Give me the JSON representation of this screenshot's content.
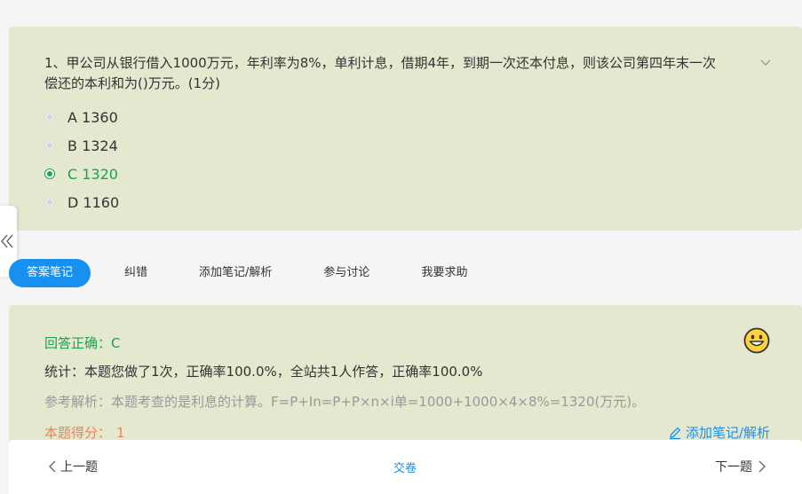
{
  "question": {
    "text": "1、甲公司从银行借入1000万元，年利率为8%，单利计息，借期4年，到期一次还本付息，则该公司第四年末一次偿还的本利和为()万元。(1分)",
    "options": [
      {
        "label": "A 1360",
        "selected": false
      },
      {
        "label": "B 1324",
        "selected": false
      },
      {
        "label": "C 1320",
        "selected": true
      },
      {
        "label": "D 1160",
        "selected": false
      }
    ]
  },
  "tabs": [
    "答案笔记",
    "纠错",
    "添加笔记/解析",
    "参与讨论",
    "我要求助"
  ],
  "answer": {
    "correct": "回答正确：C",
    "stats": "统计：本题您做了1次，正确率100.0%，全站共1人作答，正确率100.0%",
    "analysis": "参考解析：本题考查的是利息的计算。F=P+In=P+P×n×i单=1000+1000×4×8%=1320(万元)。",
    "score_label": "本题得分：",
    "score_value": "1",
    "add_note": "添加笔记/解析"
  },
  "footer": {
    "prev": "上一题",
    "submit": "交卷",
    "next": "下一题"
  },
  "colors": {
    "card_bg": "#e3e8cf",
    "accent_blue": "#1890f0",
    "correct_green": "#1aa34a",
    "score_orange": "#f08258"
  }
}
